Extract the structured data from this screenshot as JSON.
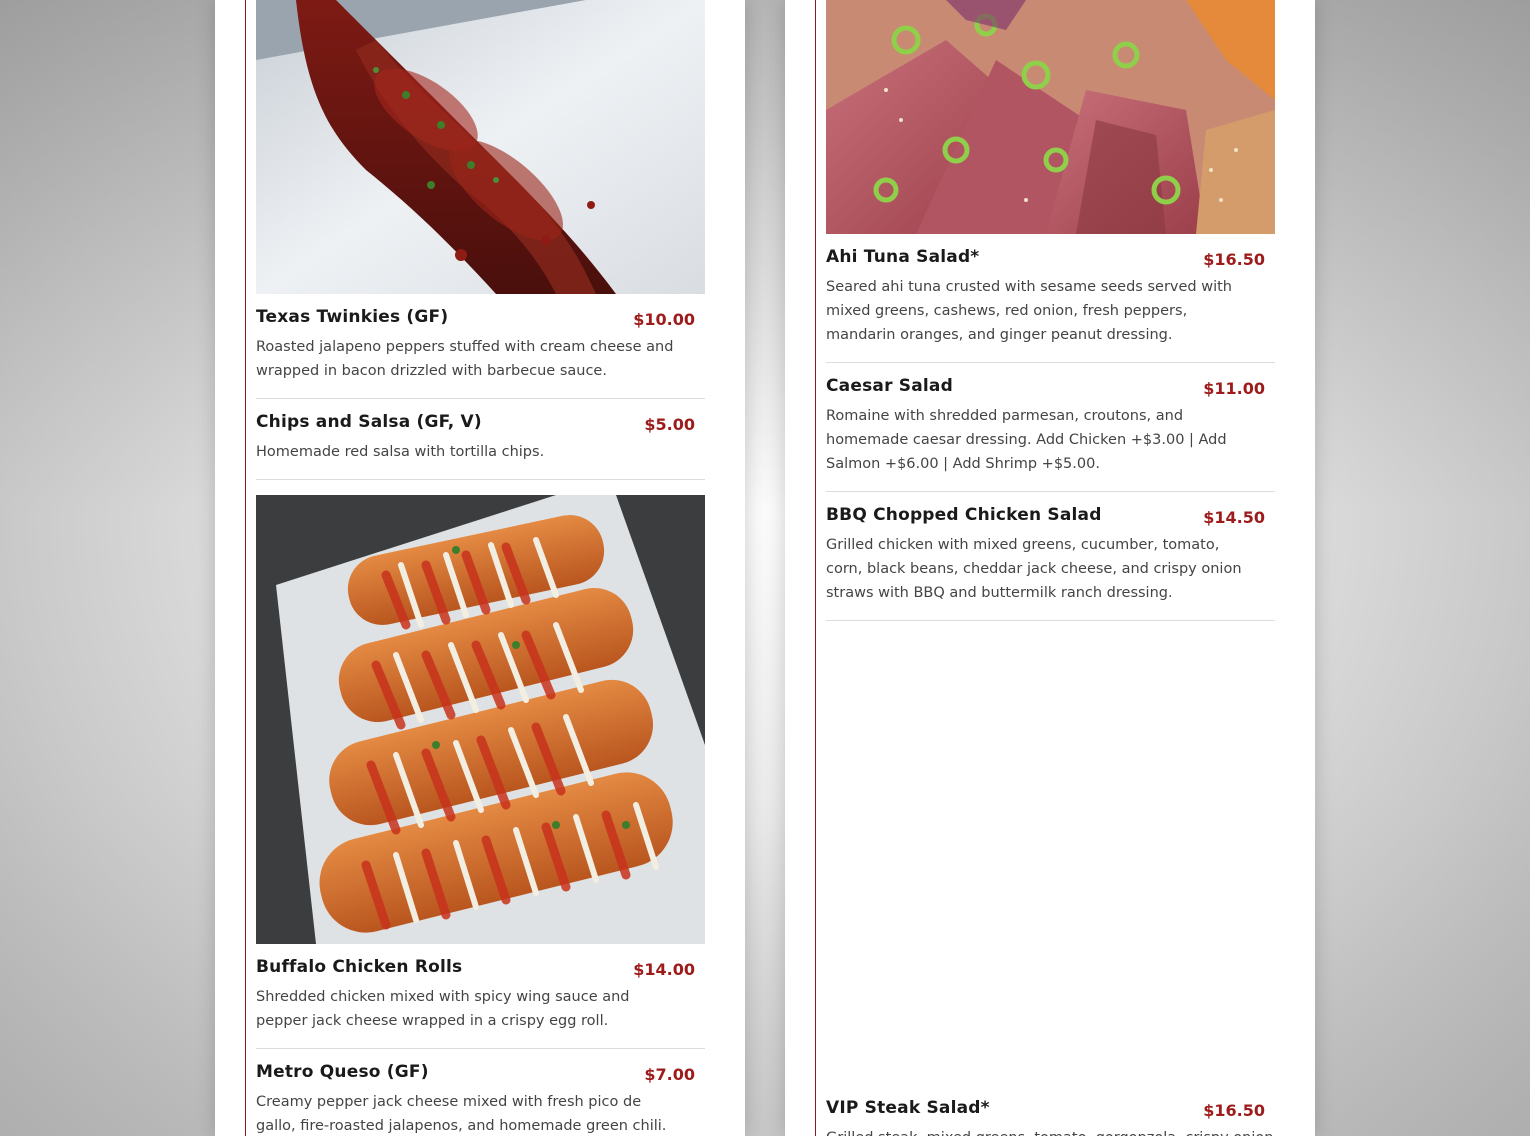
{
  "colors": {
    "accent": "#9e1b1b",
    "rule": "#8b1a1a",
    "text": "#1a1a1a",
    "desc": "#444444"
  },
  "left_column": {
    "photos": [
      {
        "name": "bacon-wrapped-jalapenos-photo",
        "alt": "Texas Twinkies"
      },
      {
        "name": "buffalo-chicken-rolls-photo",
        "alt": "Buffalo Chicken Rolls"
      }
    ],
    "items": [
      {
        "name": "Texas Twinkies (GF)",
        "price": "$10.00",
        "desc": "Roasted jalapeno peppers stuffed with cream cheese and wrapped in bacon drizzled with barbecue sauce."
      },
      {
        "name": "Chips and Salsa (GF, V)",
        "price": "$5.00",
        "desc": "Homemade red salsa with tortilla chips."
      },
      {
        "name": "Buffalo Chicken Rolls",
        "price": "$14.00",
        "desc": "Shredded chicken mixed with spicy wing sauce and pepper jack cheese wrapped in a crispy egg roll."
      },
      {
        "name": "Metro Queso (GF)",
        "price": "$7.00",
        "desc": "Creamy pepper jack cheese mixed with fresh pico de gallo, fire-roasted jalapenos, and homemade green chili."
      }
    ]
  },
  "right_column": {
    "photos": [
      {
        "name": "ahi-tuna-photo",
        "alt": "Ahi Tuna Salad"
      }
    ],
    "items": [
      {
        "name": "Ahi Tuna Salad*",
        "price": "$16.50",
        "desc": "Seared ahi tuna crusted with sesame seeds served with mixed greens, cashews, red onion, fresh peppers, mandarin oranges, and ginger peanut dressing."
      },
      {
        "name": "Caesar Salad",
        "price": "$11.00",
        "desc": "Romaine with shredded parmesan, croutons, and homemade caesar dressing. Add Chicken +$3.00 | Add Salmon +$6.00 | Add Shrimp +$5.00."
      },
      {
        "name": "BBQ Chopped Chicken Salad",
        "price": "$14.50",
        "desc": "Grilled chicken with mixed greens, cucumber, tomato, corn, black beans, cheddar jack cheese, and crispy onion straws with BBQ and buttermilk ranch dressing."
      },
      {
        "name": "VIP Steak Salad*",
        "price": "$16.50",
        "desc": "Grilled steak, mixed greens, tomato, gorgonzola, crispy onion"
      }
    ]
  }
}
